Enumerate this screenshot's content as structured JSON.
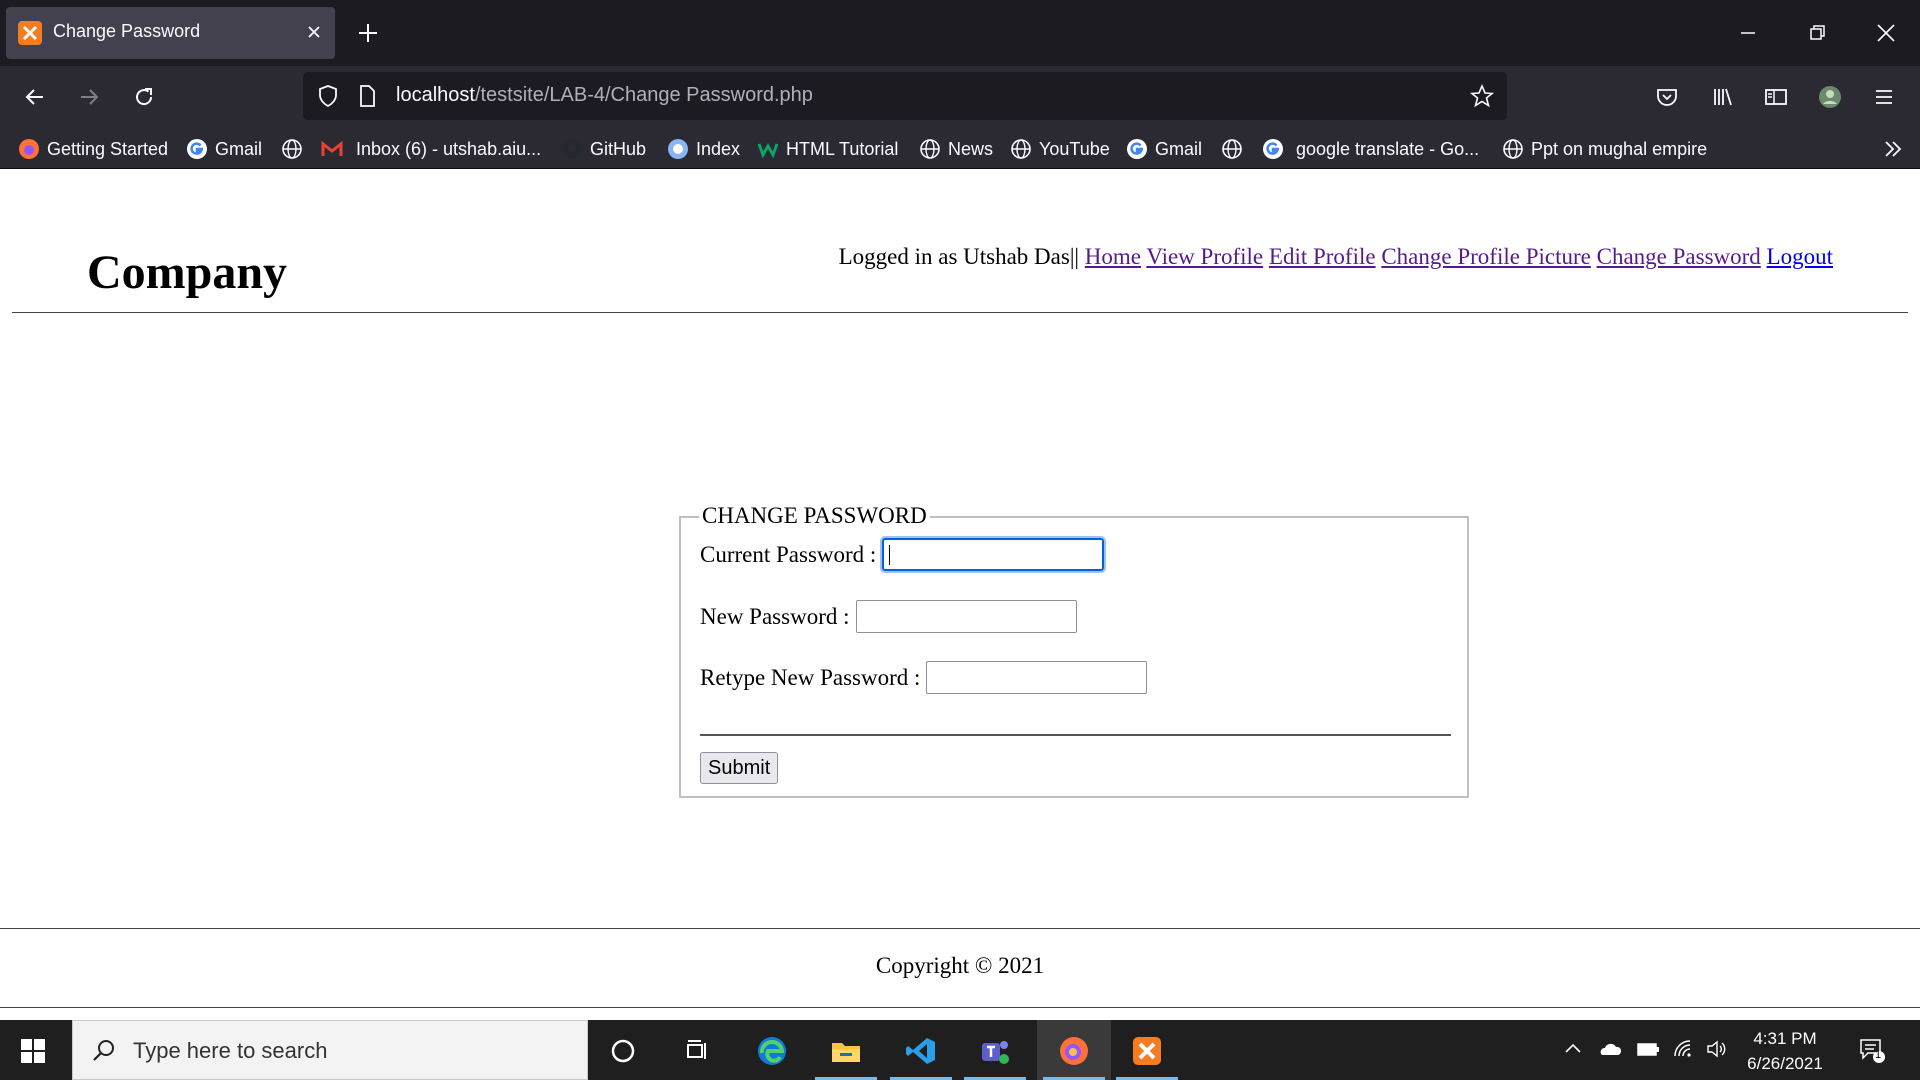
{
  "browser": {
    "tab_title": "Change Password",
    "url_host": "localhost",
    "url_path": "/testsite/LAB-4/Change Password.php"
  },
  "bookmarks": [
    {
      "label": "Getting Started",
      "icon": "firefox-icon"
    },
    {
      "label": "Gmail",
      "icon": "google-icon"
    },
    {
      "label": "",
      "icon": "globe-icon"
    },
    {
      "label": "Inbox (6) - utshab.aiu...",
      "icon": "gmail-icon"
    },
    {
      "label": "GitHub",
      "icon": "github-icon"
    },
    {
      "label": "Index",
      "icon": "index-icon"
    },
    {
      "label": "HTML Tutorial",
      "icon": "w3schools-icon"
    },
    {
      "label": "News",
      "icon": "globe-icon"
    },
    {
      "label": "YouTube",
      "icon": "globe-icon"
    },
    {
      "label": "Gmail",
      "icon": "google-icon"
    },
    {
      "label": "",
      "icon": "globe-icon"
    },
    {
      "label": "google translate - Go...",
      "icon": "google-icon"
    },
    {
      "label": "Ppt on mughal empire",
      "icon": "globe-icon"
    }
  ],
  "site": {
    "logo": "Company",
    "logged_in_text": "Logged in as Utshab Das||",
    "nav": [
      "Home",
      "View Profile",
      "Edit Profile",
      "Change Profile Picture",
      "Change Password",
      "Logout"
    ]
  },
  "form": {
    "legend": "CHANGE PASSWORD",
    "current_label": "Current Password :",
    "new_label": "New Password :",
    "retype_label": "Retype New Password :",
    "submit_label": "Submit"
  },
  "footer": {
    "copyright": "Copyright © 2021"
  },
  "taskbar": {
    "search_placeholder": "Type here to search",
    "time": "4:31 PM",
    "date": "6/26/2021",
    "notification_count": "1"
  }
}
